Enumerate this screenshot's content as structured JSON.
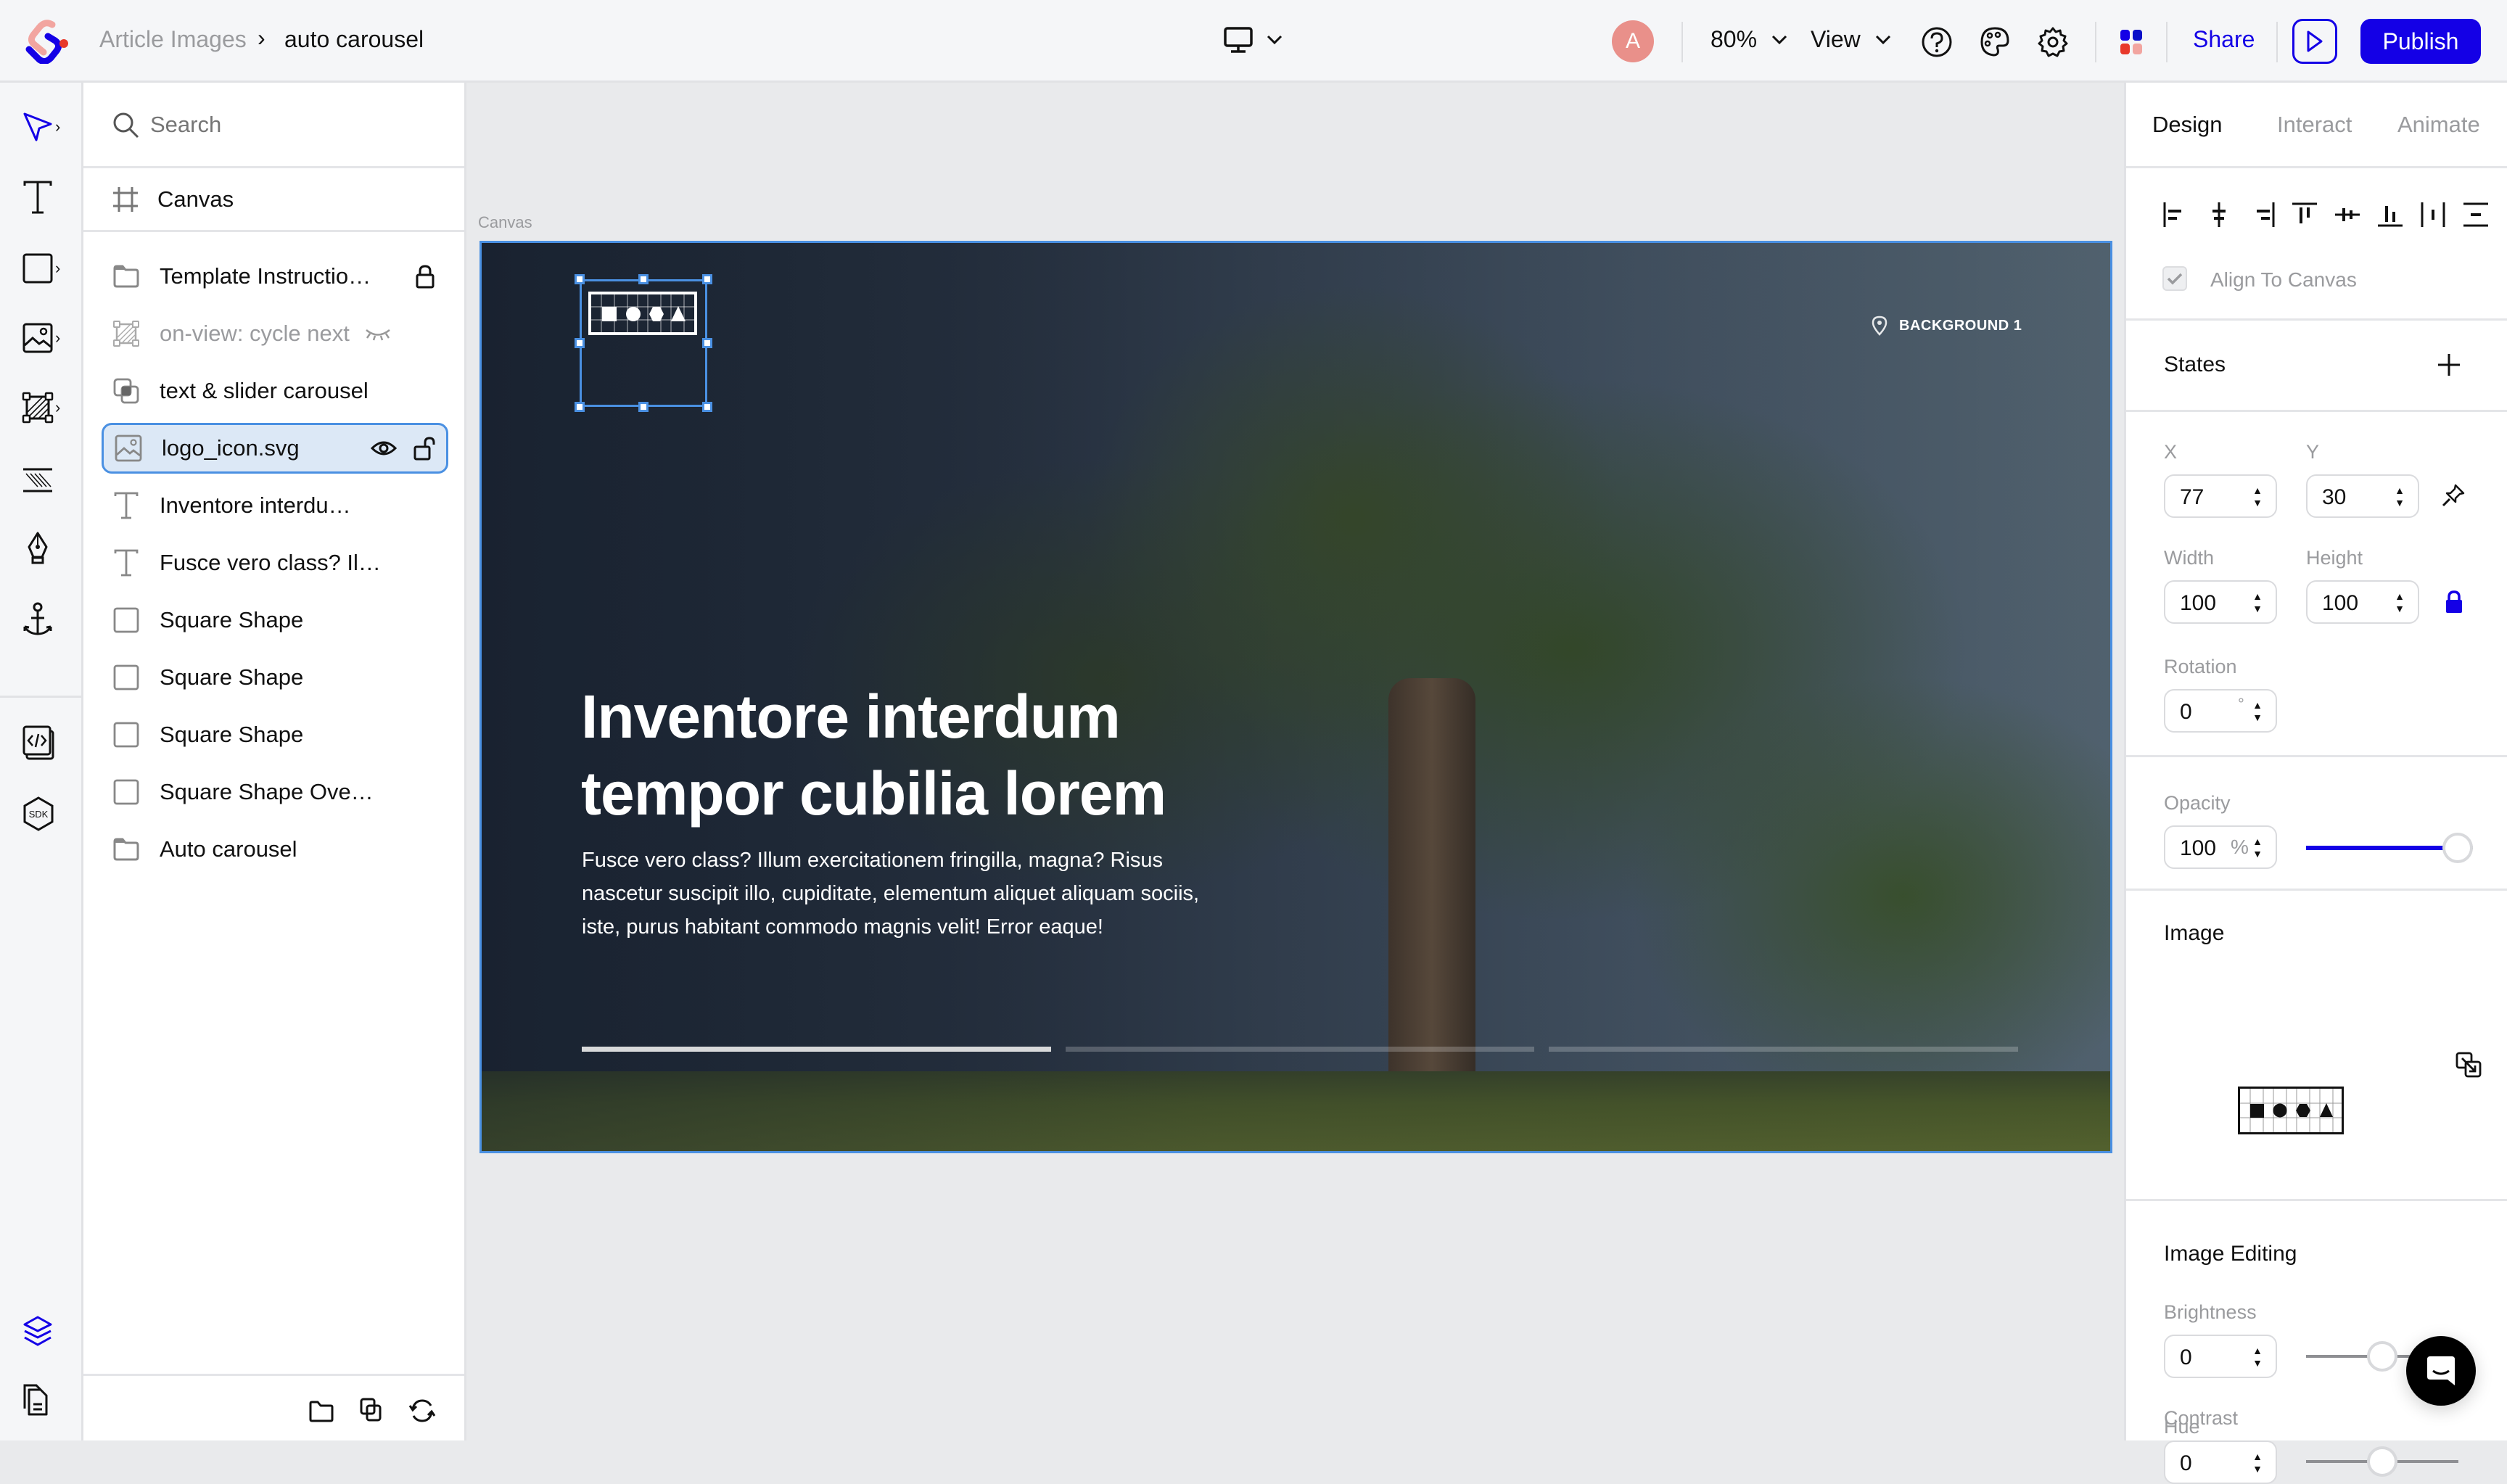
{
  "topbar": {
    "breadcrumb": {
      "parent": "Article Images",
      "separator": ">",
      "current": "auto carousel"
    },
    "device_icon": "desktop-icon",
    "avatar_initial": "A",
    "zoom_label": "80%",
    "view_label": "View",
    "share_label": "Share",
    "publish_label": "Publish",
    "colors": {
      "accent": "#1400e6",
      "avatar": "#e9908a",
      "logo_red": "#e8392b",
      "logo_pink": "#f2a5a0"
    }
  },
  "toolbar": {
    "tools": [
      {
        "name": "select-tool",
        "icon": "pointer-icon",
        "has_submenu": true,
        "active": true
      },
      {
        "name": "text-tool",
        "icon": "text-icon",
        "has_submenu": false
      },
      {
        "name": "shape-tool",
        "icon": "square-icon",
        "has_submenu": true
      },
      {
        "name": "image-tool",
        "icon": "image-icon",
        "has_submenu": true
      },
      {
        "name": "hotspot-tool",
        "icon": "hotspot-icon",
        "has_submenu": true
      },
      {
        "name": "pattern-tool",
        "icon": "pattern-icon",
        "has_submenu": false
      },
      {
        "name": "pen-tool",
        "icon": "pen-icon",
        "has_submenu": false
      },
      {
        "name": "anchor-tool",
        "icon": "anchor-icon",
        "has_submenu": false
      },
      {
        "name": "embed-tool",
        "icon": "code-icon",
        "has_submenu": false
      },
      {
        "name": "sdk-tool",
        "icon": "sdk-icon",
        "has_submenu": false
      }
    ],
    "bottom": [
      {
        "name": "layers-tab",
        "icon": "layers-icon",
        "active": true
      },
      {
        "name": "pages-tab",
        "icon": "pages-icon"
      }
    ]
  },
  "layers": {
    "search_placeholder": "Search",
    "canvas_label": "Canvas",
    "items": [
      {
        "name": "Template Instructio…",
        "icon": "folder-icon",
        "trail": "lock-icon"
      },
      {
        "name": "on-view: cycle next",
        "icon": "hotspot-icon",
        "trail": "hidden-eye-icon",
        "dim": true
      },
      {
        "name": "text & slider carousel",
        "icon": "group-icon"
      },
      {
        "name": "logo_icon.svg",
        "icon": "image-icon",
        "trail": "eye-and-unlock",
        "selected": true
      },
      {
        "name": "Inventore interdu…",
        "icon": "text-icon"
      },
      {
        "name": "Fusce vero class? Il…",
        "icon": "text-icon"
      },
      {
        "name": "Square Shape",
        "icon": "square-icon"
      },
      {
        "name": "Square Shape",
        "icon": "square-icon"
      },
      {
        "name": "Square Shape",
        "icon": "square-icon"
      },
      {
        "name": "Square Shape Ove…",
        "icon": "square-icon"
      },
      {
        "name": "Auto carousel",
        "icon": "folder-icon"
      }
    ],
    "footer_icons": [
      "new-folder-icon",
      "duplicate-icon",
      "sync-icon"
    ]
  },
  "canvas": {
    "label": "Canvas",
    "banner": {
      "location_tag": "BACKGROUND 1",
      "headline_line1": "Inventore interdum",
      "headline_line2": "tempor cubilia lorem",
      "body": "Fusce vero class? Illum exercitationem fringilla, magna? Risus nascetur suscipit illo, cupiditate, elementum aliquet aliquam sociis, iste, purus habitant commodo magnis velit! Error eaque!",
      "progress_bars": [
        {
          "fill": 1.0
        },
        {
          "fill": 0.0
        },
        {
          "fill": 0.0
        }
      ]
    }
  },
  "props": {
    "tabs": [
      {
        "label": "Design",
        "active": true
      },
      {
        "label": "Interact",
        "active": false
      },
      {
        "label": "Animate",
        "active": false
      }
    ],
    "align_icons": [
      "align-left-icon",
      "align-center-h-icon",
      "align-right-icon",
      "align-top-icon",
      "align-middle-v-icon",
      "align-bottom-icon",
      "distribute-h-icon",
      "distribute-v-icon"
    ],
    "align_to_canvas": {
      "label": "Align To Canvas",
      "checked": true
    },
    "states": {
      "label": "States"
    },
    "x": {
      "label": "X",
      "value": "77"
    },
    "y": {
      "label": "Y",
      "value": "30"
    },
    "width": {
      "label": "Width",
      "value": "100"
    },
    "height": {
      "label": "Height",
      "value": "100"
    },
    "rotation": {
      "label": "Rotation",
      "value": "0",
      "unit": "°"
    },
    "opacity": {
      "label": "Opacity",
      "value": "100",
      "unit": "%",
      "level": 1.0
    },
    "image": {
      "label": "Image"
    },
    "image_editing": {
      "label": "Image Editing",
      "brightness": {
        "label": "Brightness",
        "value": "0",
        "level": 0.5
      },
      "contrast": {
        "label": "Contrast",
        "value": "0",
        "level": 0.5
      },
      "hue": {
        "label": "Hue"
      }
    }
  }
}
